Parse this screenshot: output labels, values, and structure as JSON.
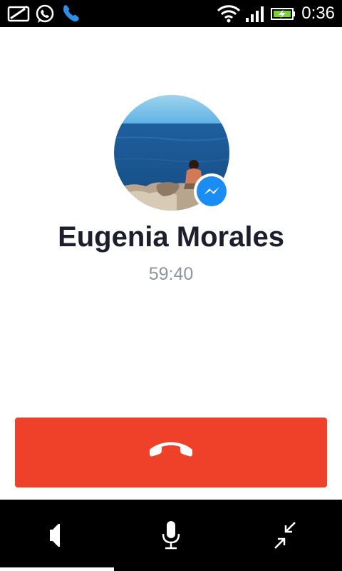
{
  "status_bar": {
    "time": "0:36",
    "left_icons": [
      "sim-card-icon",
      "whatsapp-icon",
      "phone-icon"
    ],
    "right_icons": [
      "wifi-icon",
      "signal-icon",
      "battery-charging-icon"
    ]
  },
  "caller": {
    "name": "Eugenia Morales",
    "call_duration": "59:40",
    "badge_icon": "messenger-icon"
  },
  "actions": {
    "end_call_icon": "hang-up-icon",
    "bottom_buttons": [
      "speaker-icon",
      "microphone-icon",
      "minimize-icon"
    ]
  },
  "colors": {
    "end_call": "#ef4129",
    "messenger_blue": "#1a8cf4",
    "name_text": "#1c1e2e",
    "timer_text": "#8d949e",
    "phone_icon_blue": "#2c8fe8"
  }
}
